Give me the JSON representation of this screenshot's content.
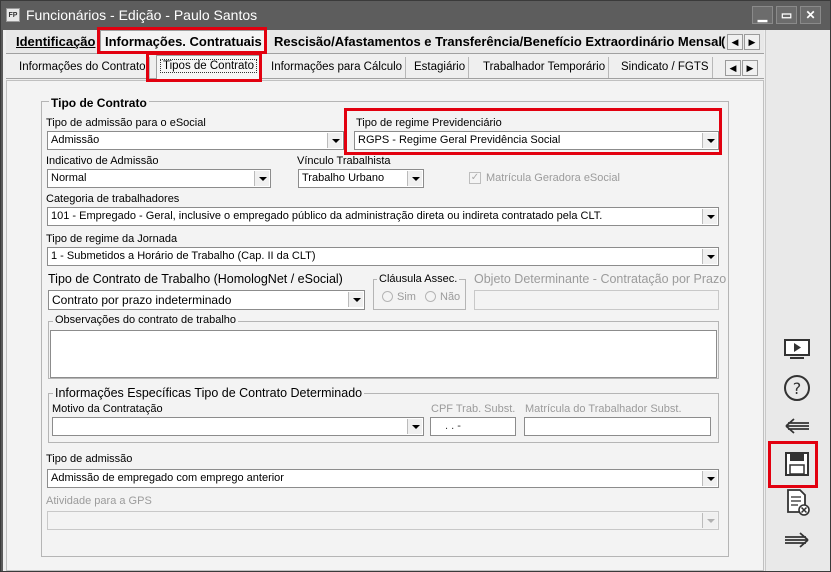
{
  "window": {
    "app_icon": "FP",
    "title": "Funcionários - Edição - Paulo Santos",
    "minimize_icon": "minimize-icon",
    "maximize_icon": "maximize-icon",
    "close_icon": "close-icon"
  },
  "tabs_main": [
    {
      "label": "Identificação"
    },
    {
      "label": "Informações. Contratuais",
      "active": true
    },
    {
      "label": "Rescisão/Afastamentos e Transferência/Benefício Extraordinário Mensal"
    },
    {
      "label": "("
    }
  ],
  "tabs_sub": [
    {
      "label": "Informações do Contrato"
    },
    {
      "label": "Tipos de Contrato",
      "active": true
    },
    {
      "label": "Informações para Cálculo"
    },
    {
      "label": "Estagiário"
    },
    {
      "label": "Trabalhador Temporário"
    },
    {
      "label": "Sindicato / FGTS"
    }
  ],
  "form": {
    "group_title": "Tipo de Contrato",
    "tipo_admissao_esocial": {
      "label": "Tipo de admissão para o eSocial",
      "value": "Admissão"
    },
    "regime_previdenciario": {
      "label": "Tipo de regime Previdenciário",
      "value": "RGPS - Regime Geral Previdência Social"
    },
    "indicativo_admissao": {
      "label": "Indicativo de Admissão",
      "value": "Normal"
    },
    "vinculo_trabalhista": {
      "label": "Vínculo Trabalhista",
      "value": "Trabalho Urbano"
    },
    "matricula_geradora": {
      "label": "Matrícula Geradora eSocial",
      "checked": true
    },
    "categoria": {
      "label": "Categoria de trabalhadores",
      "value": "101 - Empregado - Geral, inclusive o empregado público da administração direta ou indireta contratado pela CLT."
    },
    "regime_jornada": {
      "label": "Tipo de regime da Jornada",
      "value": "1 - Submetidos a Horário de Trabalho (Cap. II da CLT)"
    },
    "tipo_contrato_trabalho": {
      "label": "Tipo de Contrato de Trabalho (HomologNet / eSocial)",
      "value": "Contrato por prazo indeterminado"
    },
    "clausula_assec": {
      "label": "Cláusula Assec.",
      "sim": "Sim",
      "nao": "Não"
    },
    "objeto_determinante": {
      "label": "Objeto Determinante - Contratação por Prazo",
      "value": ""
    },
    "observacoes": {
      "label": "Observações do contrato de trabalho",
      "value": ""
    },
    "info_determinado": {
      "title": "Informações Específicas Tipo de Contrato Determinado",
      "motivo": {
        "label": "Motivo da Contratação",
        "value": ""
      },
      "cpf_subst": {
        "label": "CPF Trab. Subst.",
        "value": ". . -"
      },
      "matricula_subst": {
        "label": "Matrícula do Trabalhador Subst.",
        "value": ""
      }
    },
    "tipo_admissao": {
      "label": "Tipo de admissão",
      "value": "Admissão de empregado com emprego anterior"
    },
    "atividade_gps": {
      "label": "Atividade para a GPS",
      "value": ""
    }
  },
  "sidebar": {
    "buttons": [
      "presentation-icon",
      "help-icon",
      "back-arrow-icon",
      "save-icon",
      "cancel-document-icon",
      "forward-arrow-icon"
    ]
  },
  "colors": {
    "titlebar": "#5d5d5d",
    "highlight": "#e2000f",
    "background": "#eeeeee"
  }
}
